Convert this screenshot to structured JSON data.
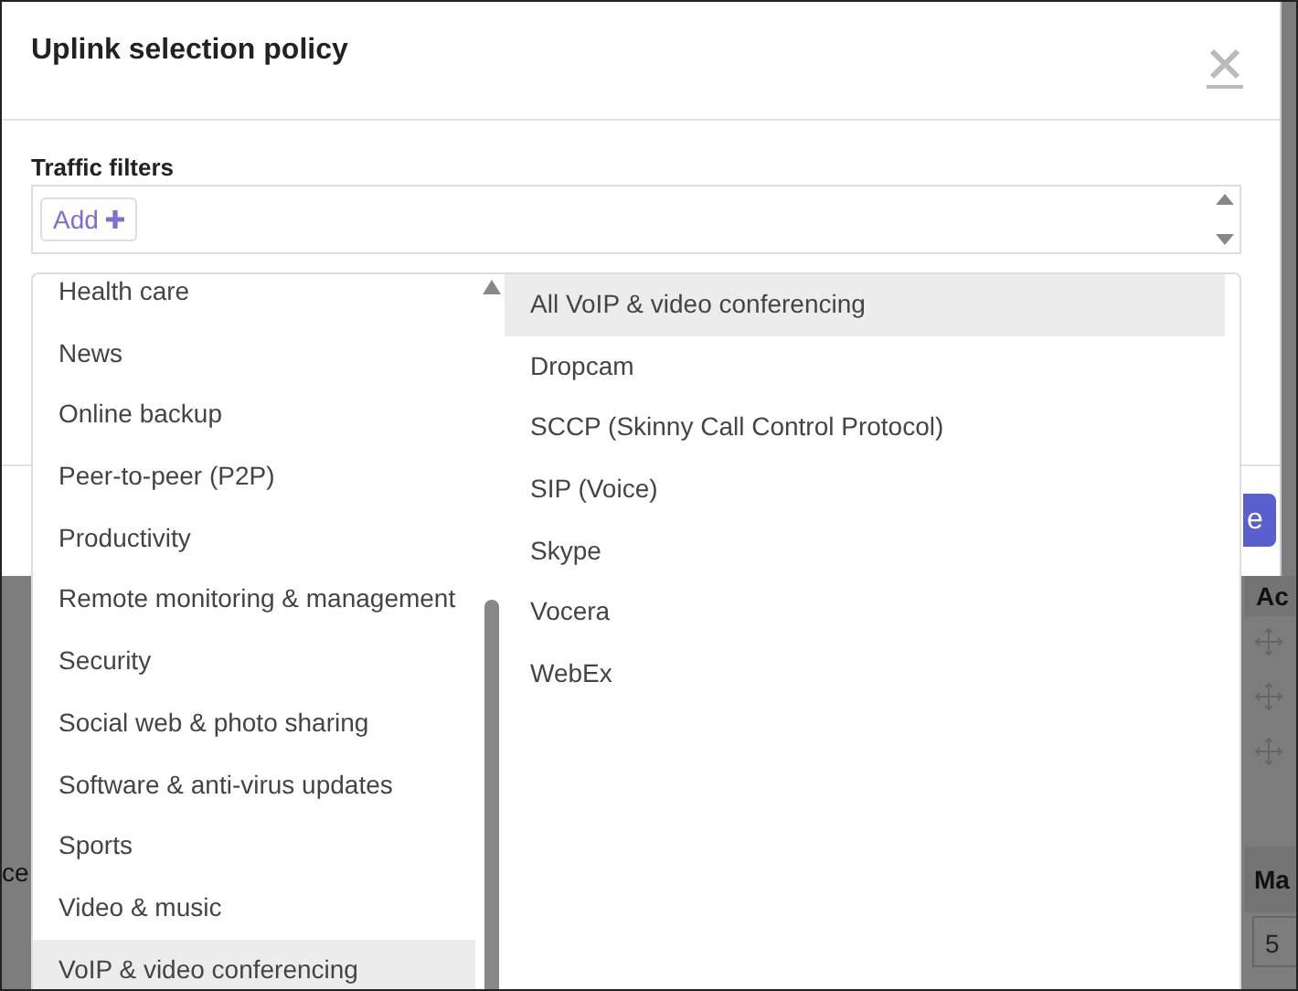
{
  "background": {
    "actions_header": "Ac",
    "side_label": "ce",
    "max_header": "Ma",
    "max_value": "5"
  },
  "modal": {
    "title": "Uplink selection policy",
    "traffic_filters_label": "Traffic filters",
    "add_button": "Add",
    "save_button": "e"
  },
  "dropdown": {
    "categories": [
      {
        "label": "Health care",
        "selected": false
      },
      {
        "label": "News",
        "selected": false
      },
      {
        "label": "Online backup",
        "selected": false
      },
      {
        "label": "Peer-to-peer (P2P)",
        "selected": false
      },
      {
        "label": "Productivity",
        "selected": false
      },
      {
        "label": "Remote monitoring & management",
        "selected": false
      },
      {
        "label": "Security",
        "selected": false
      },
      {
        "label": "Social web & photo sharing",
        "selected": false
      },
      {
        "label": "Software & anti-virus updates",
        "selected": false
      },
      {
        "label": "Sports",
        "selected": false
      },
      {
        "label": "Video & music",
        "selected": false
      },
      {
        "label": "VoIP & video conferencing",
        "selected": true
      }
    ],
    "applications": [
      {
        "label": "All VoIP & video conferencing",
        "selected": true
      },
      {
        "label": "Dropcam",
        "selected": false
      },
      {
        "label": "SCCP (Skinny Call Control Protocol)",
        "selected": false
      },
      {
        "label": "SIP (Voice)",
        "selected": false
      },
      {
        "label": "Skype",
        "selected": false
      },
      {
        "label": "Vocera",
        "selected": false
      },
      {
        "label": "WebEx",
        "selected": false
      }
    ]
  }
}
